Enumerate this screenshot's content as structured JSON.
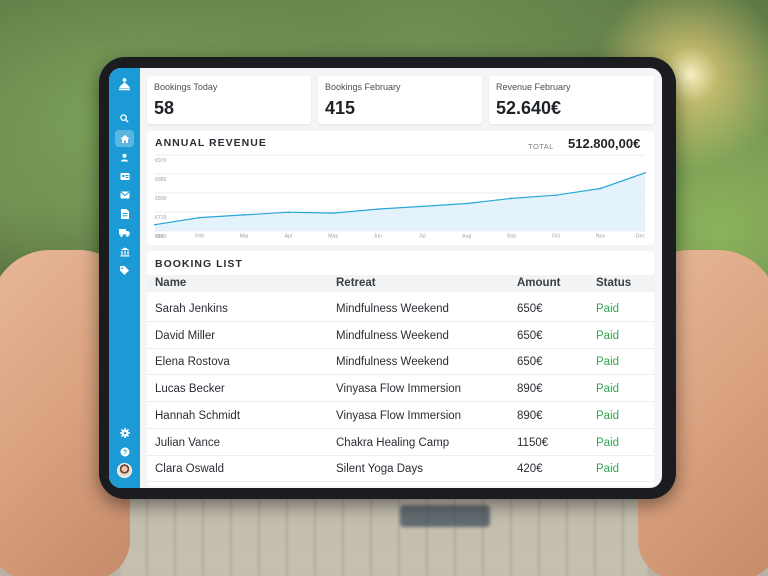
{
  "colors": {
    "sidebar": "#1c9ad6",
    "chart_line": "#2aa6d8",
    "chart_fill": "#dff1fa",
    "status_paid": "#2fa84f"
  },
  "sidebar": {
    "logo_icon": "lotus-figure-icon",
    "items": [
      {
        "icon": "search-icon"
      },
      {
        "icon": "home-icon",
        "active": true
      },
      {
        "icon": "user-icon"
      },
      {
        "icon": "contact-card-icon"
      },
      {
        "icon": "mail-icon"
      },
      {
        "icon": "document-icon"
      },
      {
        "icon": "truck-icon"
      },
      {
        "icon": "bank-icon"
      },
      {
        "icon": "tag-icon"
      }
    ],
    "bottom": [
      {
        "icon": "gear-icon"
      },
      {
        "icon": "help-icon"
      },
      {
        "icon": "avatar"
      }
    ]
  },
  "stats": [
    {
      "label": "Bookings Today",
      "value": "58"
    },
    {
      "label": "Bookings February",
      "value": "415"
    },
    {
      "label": "Revenue February",
      "value": "52.640€"
    }
  ],
  "revenue": {
    "title": "ANNUAL REVENUE",
    "total_label": "TOTAL",
    "total_value": "512.800,00€"
  },
  "chart_data": {
    "type": "area",
    "title": "ANNUAL REVENUE",
    "categories": [
      "Jan",
      "Feb",
      "Mar",
      "Apr",
      "May",
      "Jun",
      "Jul",
      "Aug",
      "Sep",
      "Oct",
      "Nov",
      "Dec"
    ],
    "y_ticks": [
      "€970",
      "€885",
      "€800",
      "€715",
      "€630"
    ],
    "ylim": [
      630,
      970
    ],
    "grid": true,
    "series": [
      {
        "values": [
          658,
          690,
          702,
          714,
          710,
          728,
          740,
          753,
          776,
          790,
          820,
          890
        ]
      }
    ]
  },
  "bookings": {
    "title": "BOOKING LIST",
    "columns": [
      "Name",
      "Retreat",
      "Amount",
      "Status"
    ],
    "rows": [
      {
        "name": "Sarah Jenkins",
        "retreat": "Mindfulness Weekend",
        "amount": "650€",
        "status": "Paid"
      },
      {
        "name": "David Miller",
        "retreat": "Mindfulness Weekend",
        "amount": "650€",
        "status": "Paid"
      },
      {
        "name": "Elena Rostova",
        "retreat": "Mindfulness Weekend",
        "amount": "650€",
        "status": "Paid"
      },
      {
        "name": "Lucas Becker",
        "retreat": "Vinyasa Flow Immersion",
        "amount": "890€",
        "status": "Paid"
      },
      {
        "name": "Hannah Schmidt",
        "retreat": "Vinyasa Flow Immersion",
        "amount": "890€",
        "status": "Paid"
      },
      {
        "name": "Julian Vance",
        "retreat": "Chakra Healing Camp",
        "amount": "1150€",
        "status": "Paid"
      },
      {
        "name": "Clara Oswald",
        "retreat": "Silent Yoga Days",
        "amount": "420€",
        "status": "Paid"
      }
    ]
  }
}
